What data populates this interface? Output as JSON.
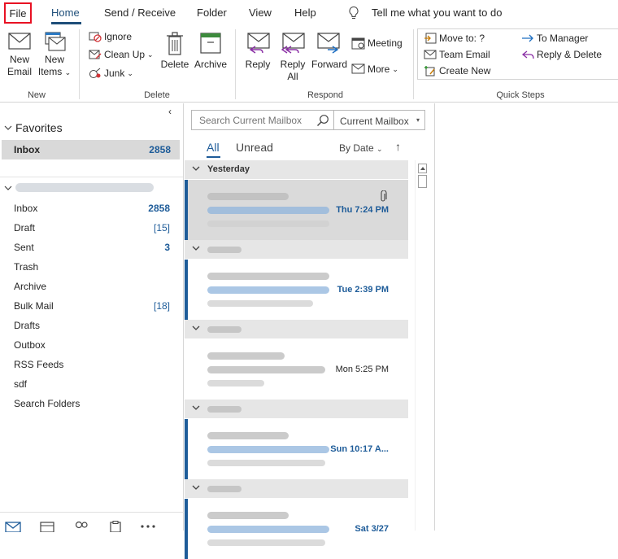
{
  "tabs": {
    "file": "File",
    "home": "Home",
    "send_receive": "Send / Receive",
    "folder": "Folder",
    "view": "View",
    "help": "Help",
    "tell_me": "Tell me what you want to do"
  },
  "ribbon": {
    "new_email": [
      "New",
      "Email"
    ],
    "new_items": [
      "New",
      "Items"
    ],
    "new_group": "New",
    "ignore": "Ignore",
    "clean_up": "Clean Up",
    "junk": "Junk",
    "delete": "Delete",
    "archive": "Archive",
    "delete_group": "Delete",
    "reply": "Reply",
    "reply_all": [
      "Reply",
      "All"
    ],
    "forward": "Forward",
    "meeting": "Meeting",
    "more": "More",
    "respond_group": "Respond",
    "qs_move_to": "Move to: ?",
    "qs_team_email": "Team Email",
    "qs_create_new": "Create New",
    "qs_to_manager": "To Manager",
    "qs_reply_delete": "Reply & Delete",
    "quicksteps_group": "Quick Steps"
  },
  "folder_pane": {
    "favorites_label": "Favorites",
    "favorites": [
      {
        "name": "Inbox",
        "count": "2858"
      }
    ],
    "folders": [
      {
        "name": "Inbox",
        "count": "2858",
        "bold": true
      },
      {
        "name": "Draft",
        "count": "[15]",
        "bold": false
      },
      {
        "name": "Sent",
        "count": "3",
        "bold": true
      },
      {
        "name": "Trash",
        "count": "",
        "bold": false
      },
      {
        "name": "Archive",
        "count": "",
        "bold": false
      },
      {
        "name": "Bulk Mail",
        "count": "[18]",
        "bold": false
      },
      {
        "name": "Drafts",
        "count": "",
        "bold": false
      },
      {
        "name": "Outbox",
        "count": "",
        "bold": false
      },
      {
        "name": "RSS Feeds",
        "count": "",
        "bold": false
      },
      {
        "name": "sdf",
        "count": "",
        "bold": false
      },
      {
        "name": "Search Folders",
        "count": "",
        "bold": false
      }
    ],
    "nav_icons": [
      "mail-icon",
      "calendar-icon",
      "people-icon",
      "tasks-icon",
      "more-icon"
    ]
  },
  "message_list": {
    "search_placeholder": "Search Current Mailbox",
    "scope": "Current Mailbox",
    "filter_all": "All",
    "filter_unread": "Unread",
    "sort_by": "By Date",
    "groups": [
      {
        "label": "Yesterday"
      },
      {
        "label": ""
      },
      {
        "label": ""
      },
      {
        "label": ""
      },
      {
        "label": ""
      }
    ],
    "messages": [
      {
        "time": "Thu 7:24 PM",
        "unread": true,
        "selected": true,
        "attachment": true
      },
      {
        "time": "Tue 2:39 PM",
        "unread": true,
        "selected": false,
        "attachment": false
      },
      {
        "time": "Mon 5:25 PM",
        "unread": false,
        "selected": false,
        "attachment": false
      },
      {
        "time": "Sun 10:17 A...",
        "unread": true,
        "selected": false,
        "attachment": false
      },
      {
        "time": "Sat 3/27",
        "unread": true,
        "selected": false,
        "attachment": false
      }
    ]
  },
  "colors": {
    "accent": "#1e5c99",
    "file_highlight": "#e81123",
    "selected_row": "#dadada",
    "group_header": "#e6e6e6"
  }
}
